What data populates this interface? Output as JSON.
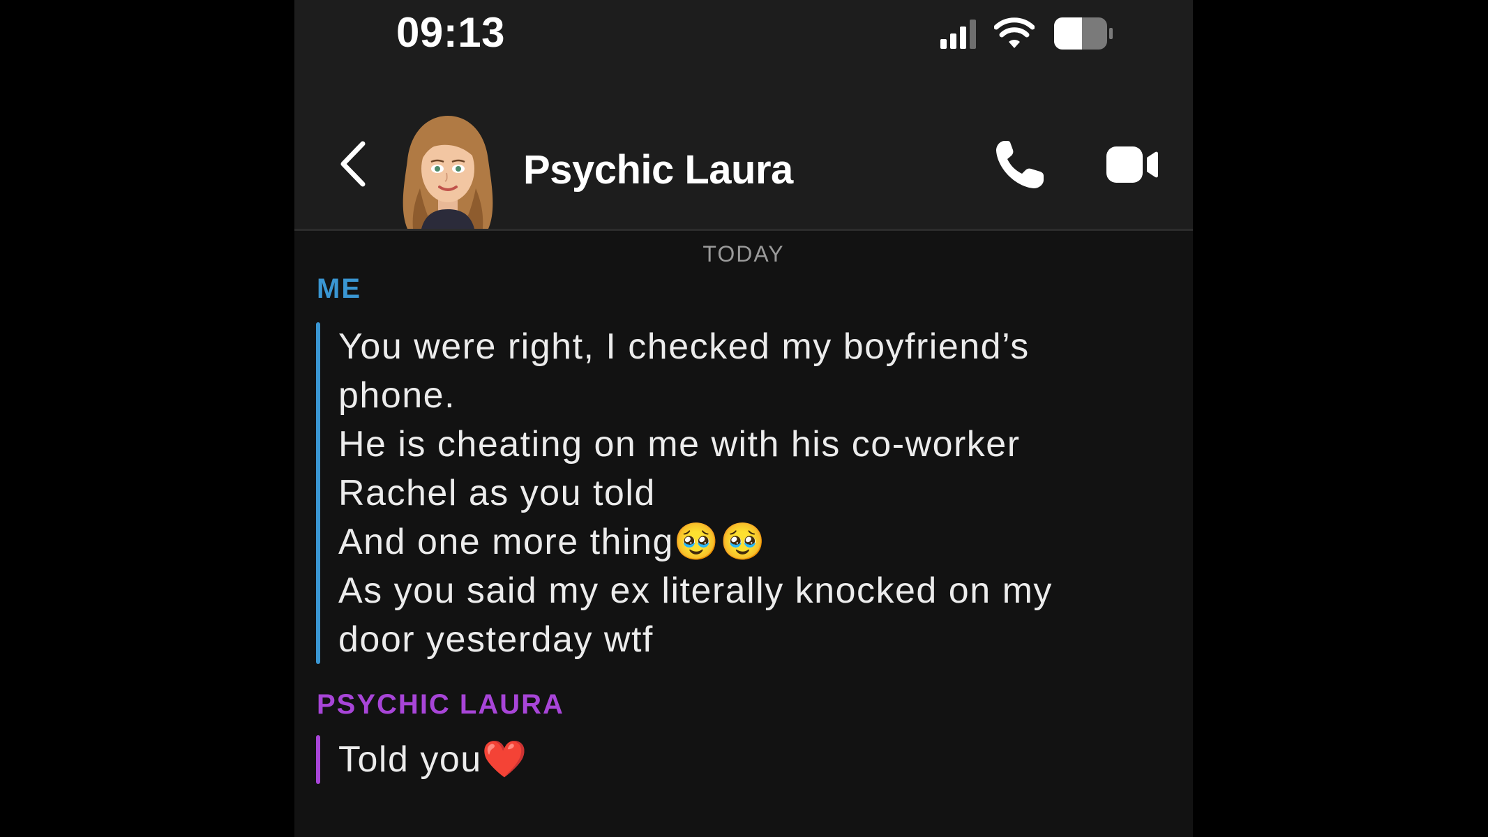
{
  "status_bar": {
    "time": "09:13",
    "icons": [
      "cellular-signal-icon",
      "wifi-icon",
      "battery-icon"
    ]
  },
  "header": {
    "back_icon": "chevron-left-icon",
    "avatar": "bitmoji-avatar",
    "contact_name": "Psychic Laura",
    "call_icon": "phone-icon",
    "video_icon": "video-camera-icon"
  },
  "chat": {
    "day_label": "TODAY",
    "messages": [
      {
        "sender": "ME",
        "sender_color": "#3a96d2",
        "lines": [
          "You were right, I checked my boyfriend’s",
          "phone.",
          "He is cheating on me with his co-worker",
          "Rachel as you told",
          "And one more thing🥹🥹",
          "As you said my ex literally knocked on my",
          "door yesterday wtf"
        ]
      },
      {
        "sender": "PSYCHIC LAURA",
        "sender_color": "#a845d8",
        "lines": [
          "Told you❤️"
        ]
      }
    ]
  },
  "colors": {
    "background": "#121212",
    "header": "#1d1d1d",
    "text": "#ececec"
  }
}
